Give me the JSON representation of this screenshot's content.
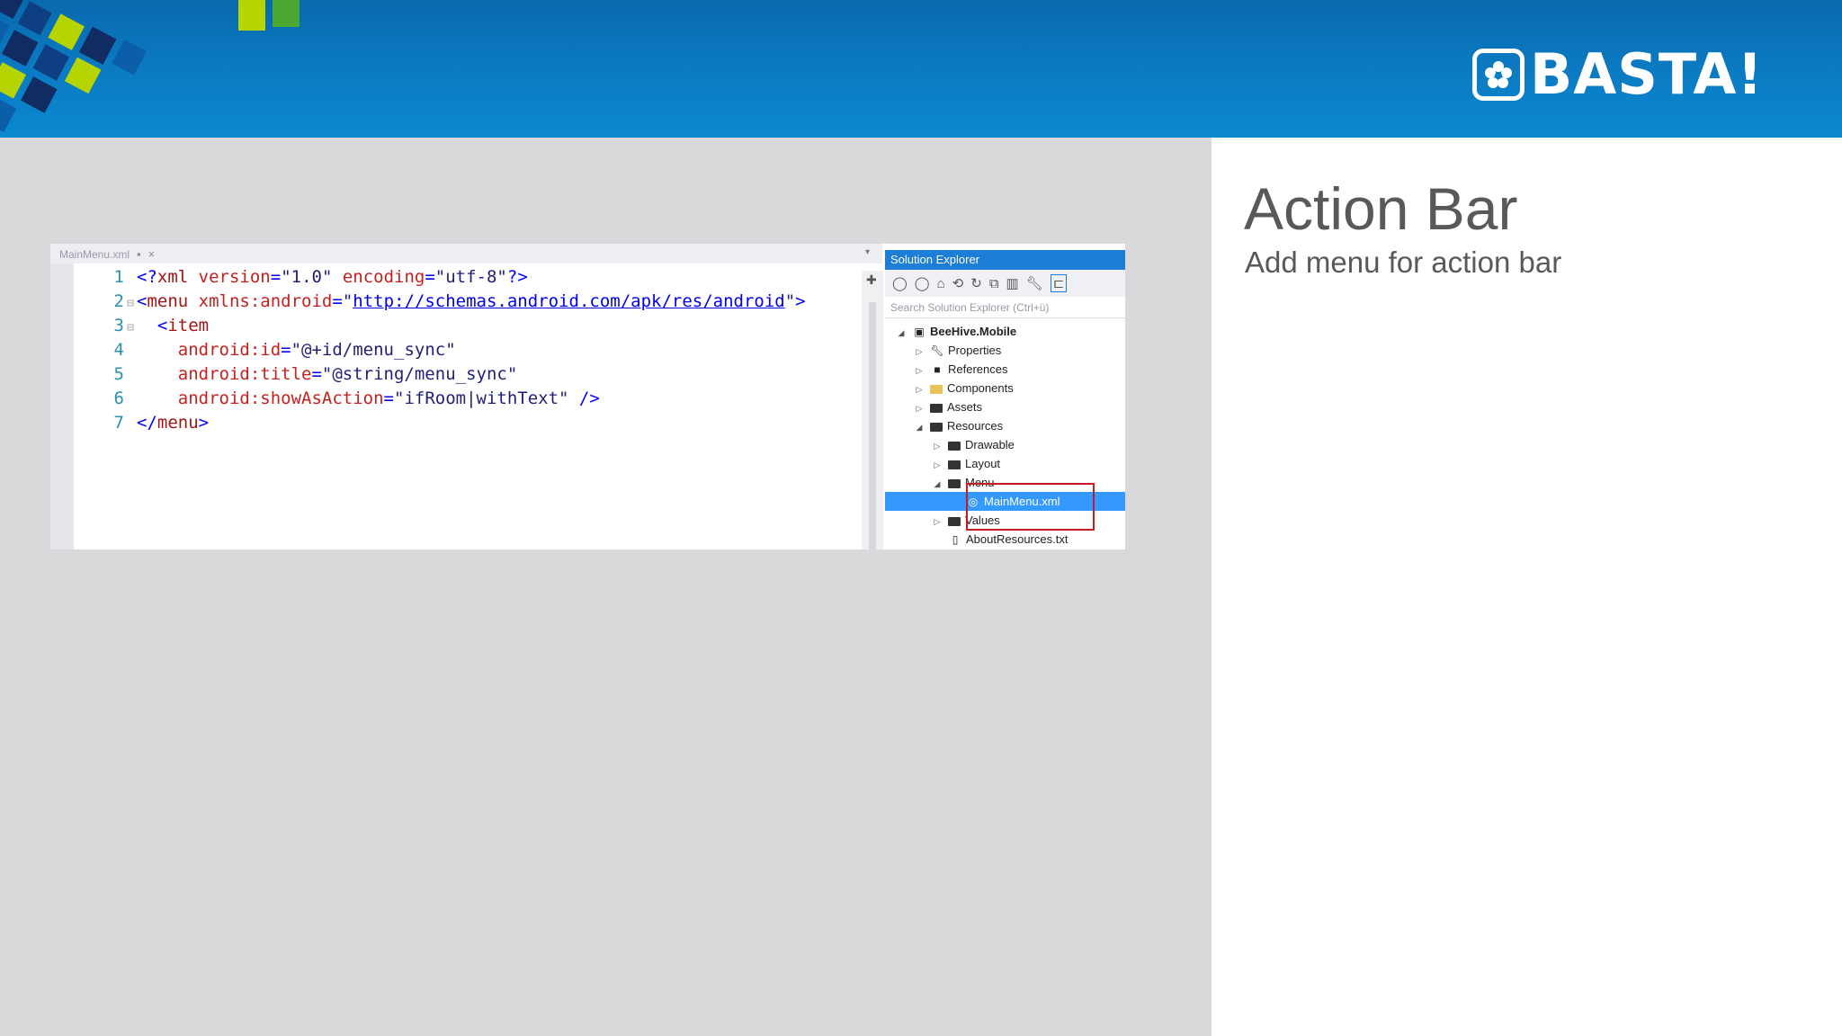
{
  "header": {
    "logo_text": "BASTA!",
    "colors": {
      "header_blue": "#0b7cc4",
      "deco_green": "#b6d400",
      "deco_navy": "#102c63"
    }
  },
  "slide": {
    "title": "Action Bar",
    "subtitle": "Add menu for action bar"
  },
  "editor": {
    "tab_label": "MainMenu.xml",
    "tab_pin": "▪",
    "tab_close": "×",
    "lines": [
      {
        "num": "1",
        "fold": "",
        "segments": [
          {
            "t": "<?",
            "c": "c-blue"
          },
          {
            "t": "xml",
            "c": "c-brown"
          },
          {
            "t": " version",
            "c": "c-red"
          },
          {
            "t": "=",
            "c": "c-blue"
          },
          {
            "t": "\"1.0\"",
            "c": "c-dk"
          },
          {
            "t": " encoding",
            "c": "c-red"
          },
          {
            "t": "=",
            "c": "c-blue"
          },
          {
            "t": "\"utf-8\"",
            "c": "c-dk"
          },
          {
            "t": "?>",
            "c": "c-blue"
          }
        ]
      },
      {
        "num": "2",
        "fold": "⊟",
        "segments": [
          {
            "t": "<",
            "c": "c-blue"
          },
          {
            "t": "menu",
            "c": "c-brown"
          },
          {
            "t": " xmlns:android",
            "c": "c-red"
          },
          {
            "t": "=",
            "c": "c-blue"
          },
          {
            "t": "\"",
            "c": "c-dk"
          },
          {
            "t": "http://schemas.android.com/apk/res/android",
            "c": "c-link"
          },
          {
            "t": "\"",
            "c": "c-dk"
          },
          {
            "t": ">",
            "c": "c-blue"
          }
        ]
      },
      {
        "num": "3",
        "fold": "⊟",
        "segments": [
          {
            "t": "  <",
            "c": "c-blue"
          },
          {
            "t": "item",
            "c": "c-brown"
          }
        ]
      },
      {
        "num": "4",
        "fold": "",
        "segments": [
          {
            "t": "    android:id",
            "c": "c-red"
          },
          {
            "t": "=",
            "c": "c-blue"
          },
          {
            "t": "\"@+id/menu_sync\"",
            "c": "c-dk"
          }
        ]
      },
      {
        "num": "5",
        "fold": "",
        "segments": [
          {
            "t": "    android:title",
            "c": "c-red"
          },
          {
            "t": "=",
            "c": "c-blue"
          },
          {
            "t": "\"@string/menu_sync\"",
            "c": "c-dk"
          }
        ]
      },
      {
        "num": "6",
        "fold": "",
        "segments": [
          {
            "t": "    android:showAsAction",
            "c": "c-red"
          },
          {
            "t": "=",
            "c": "c-blue"
          },
          {
            "t": "\"ifRoom|withText\"",
            "c": "c-dk"
          },
          {
            "t": " />",
            "c": "c-blue"
          }
        ]
      },
      {
        "num": "7",
        "fold": "",
        "segments": [
          {
            "t": "</",
            "c": "c-blue"
          },
          {
            "t": "menu",
            "c": "c-brown"
          },
          {
            "t": ">",
            "c": "c-blue"
          }
        ]
      }
    ]
  },
  "solution_explorer": {
    "title": "Solution Explorer",
    "search_placeholder": "Search Solution Explorer (Ctrl+ü)",
    "toolbar_icons": [
      "back-icon",
      "forward-icon",
      "home-icon",
      "sync-icon",
      "refresh-icon",
      "collapse-icon",
      "show-all-icon",
      "properties-icon",
      "preview-icon"
    ],
    "tree": [
      {
        "label": "BeeHive.Mobile",
        "level": 0,
        "twisty": "◢",
        "icon": "project",
        "bold": true,
        "selected": false
      },
      {
        "label": "Properties",
        "level": 1,
        "twisty": "▷",
        "icon": "wrench",
        "bold": false,
        "selected": false
      },
      {
        "label": "References",
        "level": 1,
        "twisty": "▷",
        "icon": "references",
        "bold": false,
        "selected": false
      },
      {
        "label": "Components",
        "level": 1,
        "twisty": "▷",
        "icon": "folder-yellow",
        "bold": false,
        "selected": false
      },
      {
        "label": "Assets",
        "level": 1,
        "twisty": "▷",
        "icon": "folder",
        "bold": false,
        "selected": false
      },
      {
        "label": "Resources",
        "level": 1,
        "twisty": "◢",
        "icon": "folder",
        "bold": false,
        "selected": false
      },
      {
        "label": "Drawable",
        "level": 2,
        "twisty": "▷",
        "icon": "folder",
        "bold": false,
        "selected": false
      },
      {
        "label": "Layout",
        "level": 2,
        "twisty": "▷",
        "icon": "folder",
        "bold": false,
        "selected": false
      },
      {
        "label": "Menu",
        "level": 2,
        "twisty": "◢",
        "icon": "folder",
        "bold": false,
        "selected": false
      },
      {
        "label": "MainMenu.xml",
        "level": 3,
        "twisty": "",
        "icon": "xml-file",
        "bold": false,
        "selected": true
      },
      {
        "label": "Values",
        "level": 2,
        "twisty": "▷",
        "icon": "folder",
        "bold": false,
        "selected": false
      },
      {
        "label": "AboutResources.txt",
        "level": 2,
        "twisty": "",
        "icon": "file",
        "bold": false,
        "selected": false
      }
    ]
  }
}
